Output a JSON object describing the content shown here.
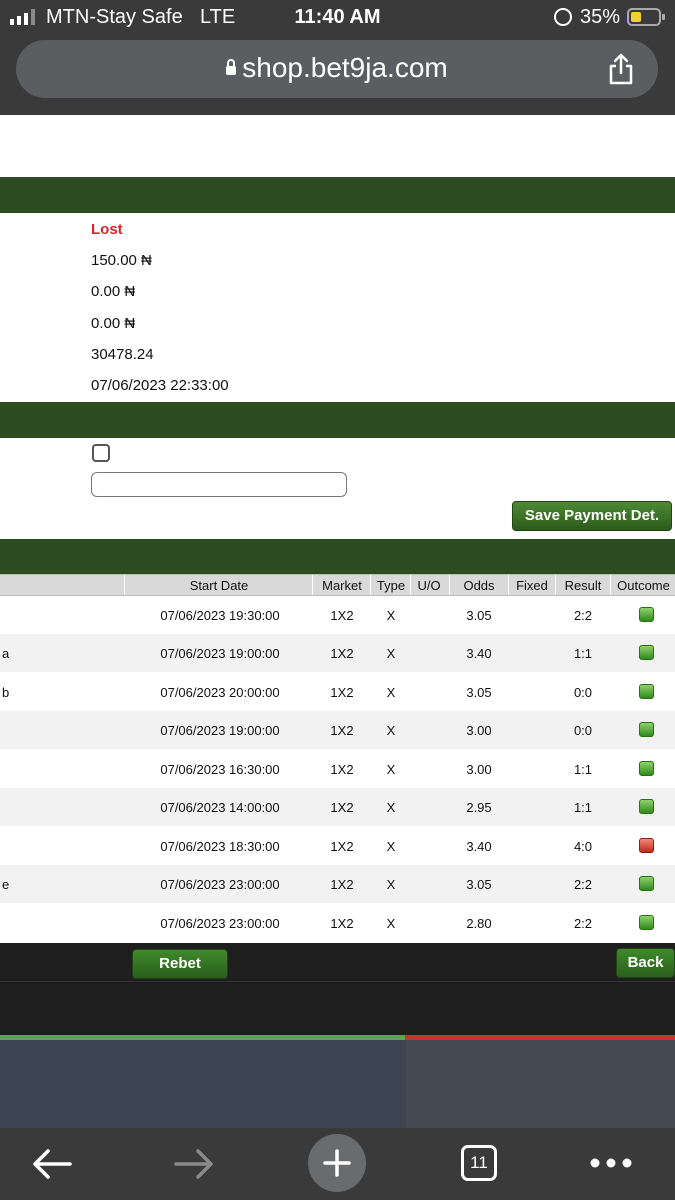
{
  "status_bar": {
    "carrier": "MTN-Stay Safe",
    "network": "LTE",
    "time": "11:40 AM",
    "battery_pct": "35%"
  },
  "browser": {
    "url": "shop.bet9ja.com",
    "tabs_count": "11"
  },
  "details": {
    "status": "Lost",
    "stake": "150.00 ₦",
    "winnings": "0.00 ₦",
    "bonus": "0.00 ₦",
    "total_odds": "30478.24",
    "date": "07/06/2023 22:33:00"
  },
  "actions": {
    "save_payment": "Save Payment Det.",
    "rebet": "Rebet",
    "back": "Back"
  },
  "table": {
    "headers": {
      "start_date": "Start Date",
      "market": "Market",
      "type": "Type",
      "uo": "U/O",
      "odds": "Odds",
      "fixed": "Fixed",
      "result": "Result",
      "outcome": "Outcome"
    },
    "rows": [
      {
        "prefix": "",
        "date": "07/06/2023 19:30:00",
        "market": "1X2",
        "type": "X",
        "odds": "3.05",
        "result": "2:2",
        "outcome": "win"
      },
      {
        "prefix": "a",
        "date": "07/06/2023 19:00:00",
        "market": "1X2",
        "type": "X",
        "odds": "3.40",
        "result": "1:1",
        "outcome": "win"
      },
      {
        "prefix": "b",
        "date": "07/06/2023 20:00:00",
        "market": "1X2",
        "type": "X",
        "odds": "3.05",
        "result": "0:0",
        "outcome": "win"
      },
      {
        "prefix": "",
        "date": "07/06/2023 19:00:00",
        "market": "1X2",
        "type": "X",
        "odds": "3.00",
        "result": "0:0",
        "outcome": "win"
      },
      {
        "prefix": "",
        "date": "07/06/2023 16:30:00",
        "market": "1X2",
        "type": "X",
        "odds": "3.00",
        "result": "1:1",
        "outcome": "win"
      },
      {
        "prefix": "",
        "date": "07/06/2023 14:00:00",
        "market": "1X2",
        "type": "X",
        "odds": "2.95",
        "result": "1:1",
        "outcome": "win"
      },
      {
        "prefix": "",
        "date": "07/06/2023 18:30:00",
        "market": "1X2",
        "type": "X",
        "odds": "3.40",
        "result": "4:0",
        "outcome": "loss"
      },
      {
        "prefix": "e",
        "date": "07/06/2023 23:00:00",
        "market": "1X2",
        "type": "X",
        "odds": "3.05",
        "result": "2:2",
        "outcome": "win"
      },
      {
        "prefix": "",
        "date": "07/06/2023 23:00:00",
        "market": "1X2",
        "type": "X",
        "odds": "2.80",
        "result": "2:2",
        "outcome": "win"
      }
    ]
  },
  "win_loss_bar": {
    "win_fraction": 0.6
  },
  "toolbar_icons": [
    "back-arrow-icon",
    "forward-arrow-icon",
    "new-tab-plus-icon",
    "tabs-icon",
    "more-icon"
  ]
}
